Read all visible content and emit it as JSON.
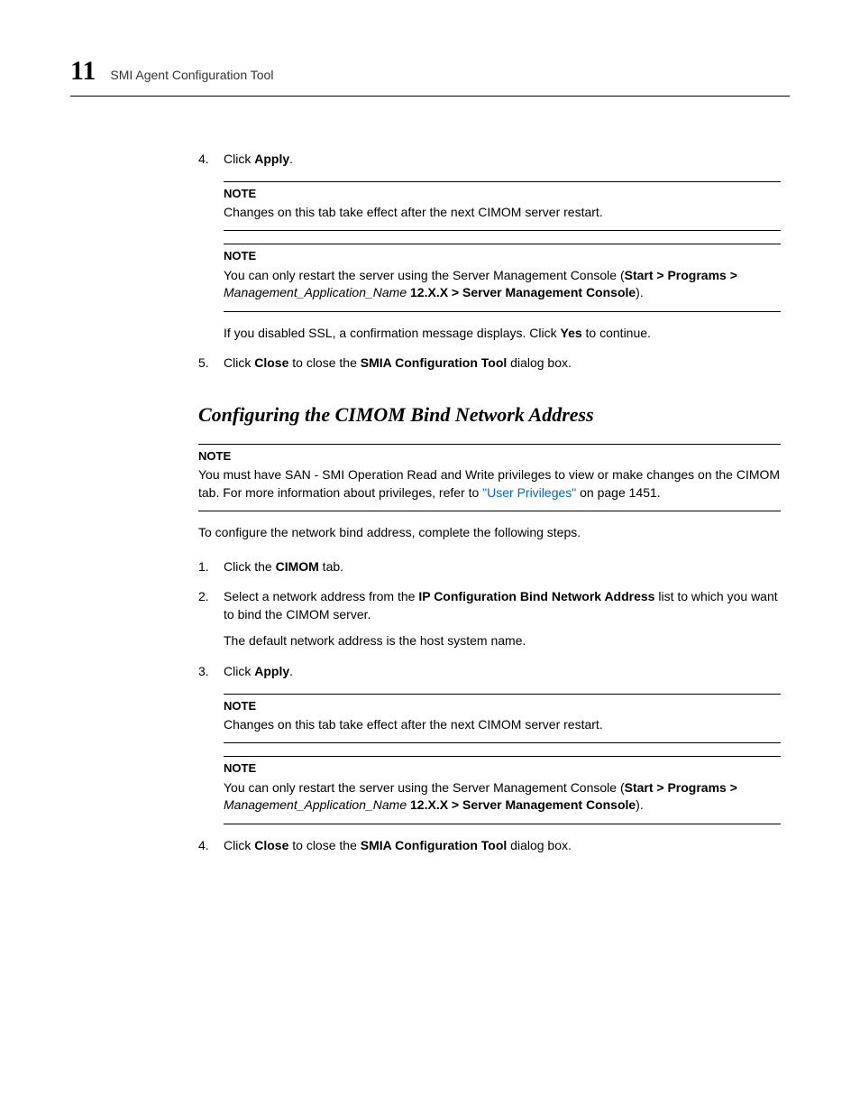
{
  "header": {
    "chapter_number": "11",
    "chapter_title": "SMI Agent Configuration Tool"
  },
  "steps_a": {
    "s4_num": "4.",
    "s4_click": "Click ",
    "s4_apply": "Apply",
    "s4_period": ".",
    "note1_label": "NOTE",
    "note1_text": "Changes on this tab take effect after the next CIMOM server restart.",
    "note2_label": "NOTE",
    "note2_p1": "You can only restart the server using the Server Management Console (",
    "note2_bold1": "Start > Programs >",
    "note2_italic": "Management_Application_Name",
    "note2_bold2": " 12.X.X > Server Management Console",
    "note2_p2": ").",
    "ssl_p1": "If you disabled SSL, a confirmation message displays. Click ",
    "ssl_bold": "Yes",
    "ssl_p2": " to continue.",
    "s5_num": "5.",
    "s5_p1": "Click ",
    "s5_close": "Close",
    "s5_p2": " to close the ",
    "s5_tool": "SMIA Configuration Tool",
    "s5_p3": " dialog box."
  },
  "section": {
    "title": "Configuring the CIMOM Bind Network Address",
    "note_label": "NOTE",
    "note_p1": "You must have SAN - SMI Operation Read and Write privileges to view or make changes on the CIMOM tab. For more information about privileges, refer to ",
    "note_link": "\"User Privileges\"",
    "note_p2": " on page 1451.",
    "intro": "To configure the network bind address, complete the following steps.",
    "s1_num": "1.",
    "s1_p1": "Click the ",
    "s1_bold": "CIMOM",
    "s1_p2": " tab.",
    "s2_num": "2.",
    "s2_p1": "Select a network address from the ",
    "s2_bold": "IP Configuration Bind Network Address",
    "s2_p2": " list to which you want to bind the CIMOM server.",
    "s2_sub": "The default network address is the host system name.",
    "s3_num": "3.",
    "s3_p1": "Click ",
    "s3_bold": "Apply",
    "s3_p2": ".",
    "note3_label": "NOTE",
    "note3_text": "Changes on this tab take effect after the next CIMOM server restart.",
    "note4_label": "NOTE",
    "note4_p1": "You can only restart the server using the Server Management Console (",
    "note4_bold1": "Start > Programs >",
    "note4_italic": "Management_Application_Name",
    "note4_bold2": " 12.X.X > Server Management Console",
    "note4_p2": ").",
    "s4_num": "4.",
    "s4_p1": "Click ",
    "s4_close": "Close",
    "s4_p2": " to close the ",
    "s4_tool": "SMIA Configuration Tool",
    "s4_p3": " dialog box."
  }
}
